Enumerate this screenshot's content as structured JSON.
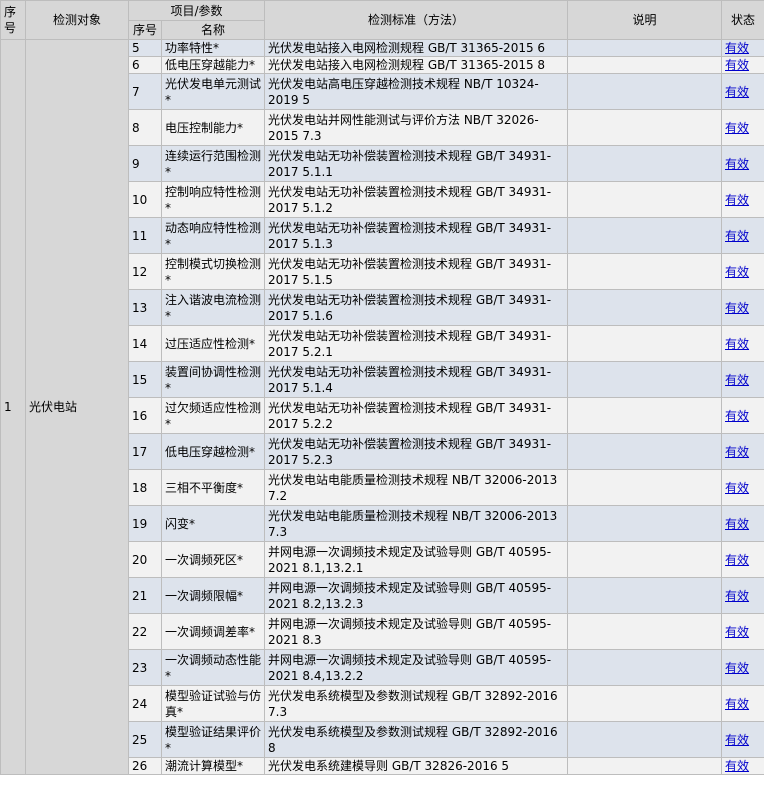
{
  "columns": {
    "seq": "序号",
    "object": "检测对象",
    "item_param": "项目/参数",
    "sub_seq": "序号",
    "sub_name": "名称",
    "standard": "检测标准（方法）",
    "note": "说明",
    "status": "状态"
  },
  "group": {
    "seq": "1",
    "object": "光伏电站"
  },
  "rows": [
    {
      "no": "5",
      "name": "功率特性*",
      "standard": "光伏发电站接入电网检测规程 GB/T 31365-2015 6",
      "status": "有效"
    },
    {
      "no": "6",
      "name": "低电压穿越能力*",
      "standard": "光伏发电站接入电网检测规程 GB/T 31365-2015 8",
      "status": "有效"
    },
    {
      "no": "7",
      "name": "光伏发电单元测试*",
      "standard": "光伏发电站高电压穿越检测技术规程 NB/T 10324-2019 5",
      "status": "有效"
    },
    {
      "no": "8",
      "name": "电压控制能力*",
      "standard": "光伏发电站并网性能测试与评价方法 NB/T 32026-2015 7.3",
      "status": "有效"
    },
    {
      "no": "9",
      "name": "连续运行范围检测*",
      "standard": "光伏发电站无功补偿装置检测技术规程 GB/T 34931-2017 5.1.1",
      "status": "有效"
    },
    {
      "no": "10",
      "name": "控制响应特性检测*",
      "standard": "光伏发电站无功补偿装置检测技术规程 GB/T 34931-2017 5.1.2",
      "status": "有效"
    },
    {
      "no": "11",
      "name": "动态响应特性检测*",
      "standard": "光伏发电站无功补偿装置检测技术规程 GB/T 34931-2017 5.1.3",
      "status": "有效"
    },
    {
      "no": "12",
      "name": "控制模式切换检测*",
      "standard": "光伏发电站无功补偿装置检测技术规程 GB/T 34931-2017 5.1.5",
      "status": "有效"
    },
    {
      "no": "13",
      "name": "注入谐波电流检测*",
      "standard": "光伏发电站无功补偿装置检测技术规程 GB/T 34931-2017 5.1.6",
      "status": "有效"
    },
    {
      "no": "14",
      "name": "过压适应性检测*",
      "standard": "光伏发电站无功补偿装置检测技术规程 GB/T 34931-2017 5.2.1",
      "status": "有效"
    },
    {
      "no": "15",
      "name": "装置间协调性检测*",
      "standard": "光伏发电站无功补偿装置检测技术规程 GB/T 34931-2017 5.1.4",
      "status": "有效"
    },
    {
      "no": "16",
      "name": "过欠频适应性检测*",
      "standard": "光伏发电站无功补偿装置检测技术规程 GB/T 34931-2017 5.2.2",
      "status": "有效"
    },
    {
      "no": "17",
      "name": "低电压穿越检测*",
      "standard": "光伏发电站无功补偿装置检测技术规程 GB/T 34931-2017 5.2.3",
      "status": "有效"
    },
    {
      "no": "18",
      "name": "三相不平衡度*",
      "standard": "光伏发电站电能质量检测技术规程 NB/T 32006-2013 7.2",
      "status": "有效"
    },
    {
      "no": "19",
      "name": "闪变*",
      "standard": "光伏发电站电能质量检测技术规程 NB/T 32006-2013 7.3",
      "status": "有效"
    },
    {
      "no": "20",
      "name": "一次调频死区*",
      "standard": "并网电源一次调频技术规定及试验导则 GB/T 40595-2021 8.1,13.2.1",
      "status": "有效"
    },
    {
      "no": "21",
      "name": "一次调频限幅*",
      "standard": "并网电源一次调频技术规定及试验导则 GB/T 40595-2021 8.2,13.2.3",
      "status": "有效"
    },
    {
      "no": "22",
      "name": "一次调频调差率*",
      "standard": "并网电源一次调频技术规定及试验导则 GB/T 40595-2021 8.3",
      "status": "有效"
    },
    {
      "no": "23",
      "name": "一次调频动态性能*",
      "standard": "并网电源一次调频技术规定及试验导则 GB/T 40595-2021 8.4,13.2.2",
      "status": "有效"
    },
    {
      "no": "24",
      "name": "模型验证试验与仿真*",
      "standard": "光伏发电系统模型及参数测试规程 GB/T 32892-2016 7.3",
      "status": "有效"
    },
    {
      "no": "25",
      "name": "模型验证结果评价*",
      "standard": "光伏发电系统模型及参数测试规程 GB/T 32892-2016 8",
      "status": "有效"
    },
    {
      "no": "26",
      "name": "潮流计算模型*",
      "standard": "光伏发电系统建模导则 GB/T 32826-2016 5",
      "status": "有效"
    }
  ]
}
